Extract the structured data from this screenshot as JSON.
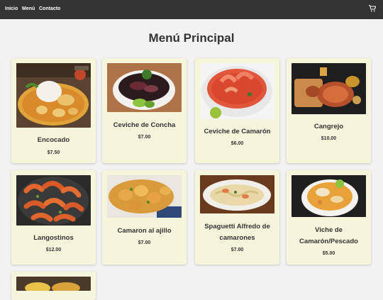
{
  "nav": {
    "links": [
      "Inicio",
      "Menú",
      "Contacto"
    ],
    "cart_icon": "cart-icon"
  },
  "page_title": "Menú Principal",
  "colors": {
    "navbar": "#333333",
    "card_bg": "#f5f5dc",
    "page_bg": "#f2f2f2"
  },
  "dishes": [
    {
      "name": "Encocado",
      "price": "$7.50"
    },
    {
      "name": "Ceviche de Concha",
      "price": "$7.00"
    },
    {
      "name": "Ceviche de Camarón",
      "price": "$6.00"
    },
    {
      "name": "Cangrejo",
      "price": "$10.00"
    },
    {
      "name": "Langostinos",
      "price": "$12.00"
    },
    {
      "name": "Camaron al ajillo",
      "price": "$7.00"
    },
    {
      "name": "Spaguetti Alfredo de camarones",
      "price": "$7.00"
    },
    {
      "name": "Viche de Camarón/Pescado",
      "price": "$5.00"
    }
  ]
}
